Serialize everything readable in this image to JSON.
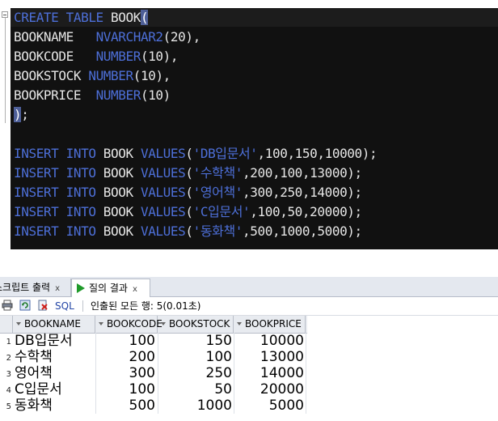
{
  "editor": {
    "lines": [
      [
        {
          "t": "CREATE TABLE ",
          "c": "kw"
        },
        {
          "t": "BOOK",
          "c": "plain"
        },
        {
          "t": "(",
          "c": "paren-hl"
        }
      ],
      [
        {
          "t": "BOOKNAME   ",
          "c": "plain"
        },
        {
          "t": "NVARCHAR2",
          "c": "kw"
        },
        {
          "t": "(20),",
          "c": "plain"
        }
      ],
      [
        {
          "t": "BOOKCODE   ",
          "c": "plain"
        },
        {
          "t": "NUMBER",
          "c": "kw"
        },
        {
          "t": "(10),",
          "c": "plain"
        }
      ],
      [
        {
          "t": "BOOKSTOCK ",
          "c": "plain"
        },
        {
          "t": "NUMBER",
          "c": "kw"
        },
        {
          "t": "(10),",
          "c": "plain"
        }
      ],
      [
        {
          "t": "BOOKPRICE  ",
          "c": "plain"
        },
        {
          "t": "NUMBER",
          "c": "kw"
        },
        {
          "t": "(10)",
          "c": "plain"
        }
      ],
      [
        {
          "t": ")",
          "c": "paren-hl2"
        },
        {
          "t": ";",
          "c": "plain"
        }
      ],
      [],
      [
        {
          "t": "INSERT INTO ",
          "c": "kw"
        },
        {
          "t": "BOOK ",
          "c": "plain"
        },
        {
          "t": "VALUES",
          "c": "kw"
        },
        {
          "t": "(",
          "c": "plain"
        },
        {
          "t": "'DB입문서'",
          "c": "str"
        },
        {
          "t": ",100,150,10000);",
          "c": "plain"
        }
      ],
      [
        {
          "t": "INSERT INTO ",
          "c": "kw"
        },
        {
          "t": "BOOK ",
          "c": "plain"
        },
        {
          "t": "VALUES",
          "c": "kw"
        },
        {
          "t": "(",
          "c": "plain"
        },
        {
          "t": "'수학책'",
          "c": "str"
        },
        {
          "t": ",200,100,13000);",
          "c": "plain"
        }
      ],
      [
        {
          "t": "INSERT INTO ",
          "c": "kw"
        },
        {
          "t": "BOOK ",
          "c": "plain"
        },
        {
          "t": "VALUES",
          "c": "kw"
        },
        {
          "t": "(",
          "c": "plain"
        },
        {
          "t": "'영어책'",
          "c": "str"
        },
        {
          "t": ",300,250,14000);",
          "c": "plain"
        }
      ],
      [
        {
          "t": "INSERT INTO ",
          "c": "kw"
        },
        {
          "t": "BOOK ",
          "c": "plain"
        },
        {
          "t": "VALUES",
          "c": "kw"
        },
        {
          "t": "(",
          "c": "plain"
        },
        {
          "t": "'C입문서'",
          "c": "str"
        },
        {
          "t": ",100,50,20000);",
          "c": "plain"
        }
      ],
      [
        {
          "t": "INSERT INTO ",
          "c": "kw"
        },
        {
          "t": "BOOK ",
          "c": "plain"
        },
        {
          "t": "VALUES",
          "c": "kw"
        },
        {
          "t": "(",
          "c": "plain"
        },
        {
          "t": "'동화책'",
          "c": "str"
        },
        {
          "t": ",500,1000,5000);",
          "c": "plain"
        }
      ]
    ]
  },
  "tabs": {
    "script_output": "스크립트 출력",
    "query_result": "질의 결과",
    "close_glyph": "x"
  },
  "toolbar": {
    "sql_label": "SQL",
    "status": "인출된 모든 행: 5(0.01초)"
  },
  "grid": {
    "columns": [
      "BOOKNAME",
      "BOOKCODE",
      "BOOKSTOCK",
      "BOOKPRICE"
    ],
    "rows": [
      {
        "num": "1",
        "name": "DB입문서",
        "code": "100",
        "stock": "150",
        "price": "10000"
      },
      {
        "num": "2",
        "name": "수학책",
        "code": "200",
        "stock": "100",
        "price": "13000"
      },
      {
        "num": "3",
        "name": "영어책",
        "code": "300",
        "stock": "250",
        "price": "14000"
      },
      {
        "num": "4",
        "name": "C입문서",
        "code": "100",
        "stock": "50",
        "price": "20000"
      },
      {
        "num": "5",
        "name": "동화책",
        "code": "500",
        "stock": "1000",
        "price": "5000"
      }
    ]
  },
  "colors": {
    "keyword": "#4d6fd8",
    "editor_bg": "#111111",
    "run_icon": "#1f9a2a"
  }
}
